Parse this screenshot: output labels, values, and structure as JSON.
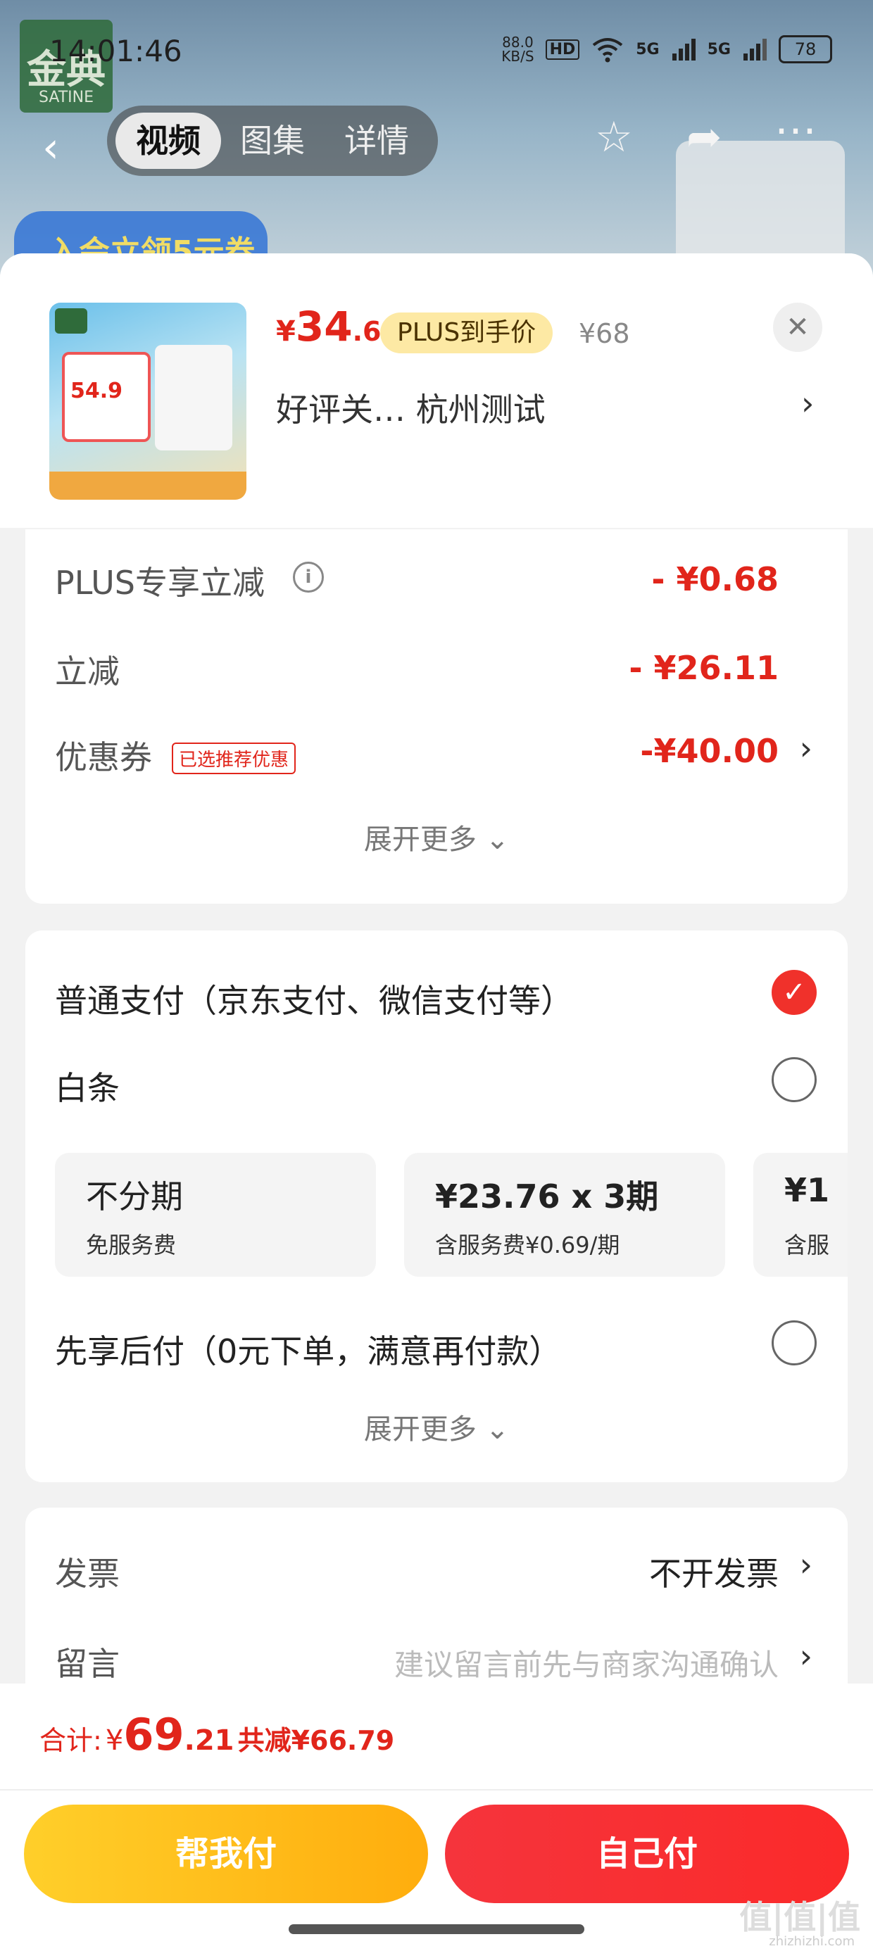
{
  "status": {
    "time": "14:01:46",
    "net_speed": "88.0",
    "net_unit": "KB/S",
    "hd": "HD",
    "five_g_1": "5G",
    "five_g_2": "5G",
    "battery": "78"
  },
  "background": {
    "logo_cn": "金典",
    "logo_en": "SATINE",
    "banner": "入会立领5元券"
  },
  "topnav": {
    "tabs": [
      {
        "label": "视频"
      },
      {
        "label": "图集"
      },
      {
        "label": "详情"
      }
    ]
  },
  "product": {
    "price_yen": "¥",
    "price_int": "34",
    "price_dec": ".6",
    "plus_badge": "PLUS到手价",
    "original_price": "¥68",
    "title": "好评关…  杭州测试",
    "thumb_price": "54.9"
  },
  "discounts": {
    "rows": [
      {
        "label": "PLUS专享立减",
        "value": "- ¥0.68"
      },
      {
        "label": "立减",
        "value": "- ¥26.11"
      },
      {
        "label": "优惠券",
        "tag": "已选推荐优惠",
        "value": "-¥40.00"
      }
    ],
    "expand": "展开更多"
  },
  "payment": {
    "options": [
      {
        "label": "普通支付（京东支付、微信支付等）",
        "checked": true
      },
      {
        "label": "白条",
        "checked": false
      },
      {
        "label": "先享后付（0元下单，满意再付款）",
        "checked": false
      }
    ],
    "installments": [
      {
        "title": "不分期",
        "sub": "免服务费"
      },
      {
        "title": "¥23.76 x 3期",
        "sub": "含服务费¥0.69/期"
      },
      {
        "title": "¥1",
        "sub": "含服"
      }
    ],
    "expand": "展开更多"
  },
  "extra": {
    "invoice_label": "发票",
    "invoice_value": "不开发票",
    "message_label": "留言",
    "message_placeholder": "建议留言前先与商家沟通确认"
  },
  "footer": {
    "total_label": "合计:",
    "total_yen": "¥",
    "total_int": "69",
    "total_dec": ".21",
    "saved": "共减¥66.79",
    "help_button": "帮我付",
    "self_button": "自己付"
  },
  "watermark": {
    "main": "值|值|值",
    "sub": "zhizhizhi.com"
  }
}
